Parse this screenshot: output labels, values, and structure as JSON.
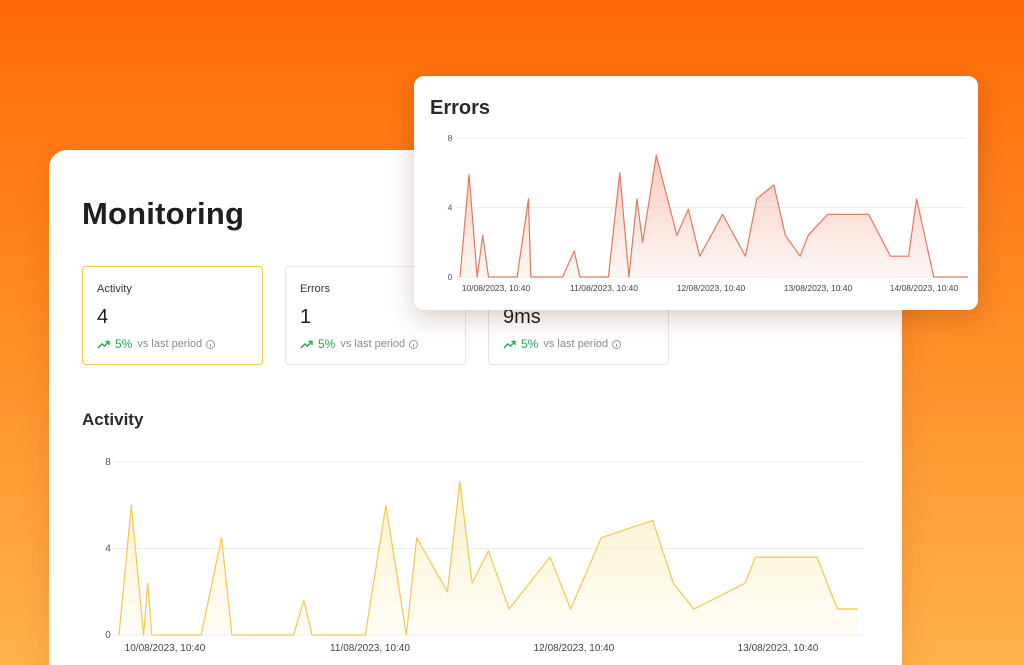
{
  "monitoring": {
    "title": "Monitoring",
    "stats": [
      {
        "label": "Activity",
        "value": "4",
        "trend_pct": "5%",
        "trend_text": "vs last period"
      },
      {
        "label": "Errors",
        "value": "1",
        "trend_pct": "5%",
        "trend_text": "vs last period"
      },
      {
        "label": "",
        "value": "9ms",
        "trend_pct": "5%",
        "trend_text": "vs last period"
      }
    ],
    "activity_title": "Activity"
  },
  "errors_card": {
    "title": "Errors"
  },
  "colors": {
    "activity_line": "#f2c94c",
    "activity_fill": "#fdf1c9",
    "errors_line": "#e07a5f",
    "errors_fill": "#f7c9bb",
    "trend_green": "#22a85a",
    "selected_border": "#f2c94c"
  },
  "chart_data": [
    {
      "type": "area",
      "title": "Errors",
      "ylim": [
        0,
        8
      ],
      "yticks": [
        "0",
        "4",
        "8"
      ],
      "xticks": [
        "10/08/2023, 10:40",
        "11/08/2023, 10:40",
        "12/08/2023, 10:40",
        "13/08/2023, 10:40",
        "14/08/2023, 10:40"
      ],
      "x_range": [
        0,
        4.38
      ],
      "grid": true,
      "series": [
        {
          "x": [
            0,
            0.08,
            0.15,
            0.2,
            0.25,
            0.3,
            0.5,
            0.6,
            0.62,
            0.68,
            0.9,
            1.0,
            1.05,
            1.12,
            1.3,
            1.4,
            1.48,
            1.55,
            1.6,
            1.72,
            1.9,
            2.0,
            2.1,
            2.3,
            2.5,
            2.6,
            2.75,
            2.85,
            2.98,
            3.05,
            3.22,
            3.33,
            3.42,
            3.58,
            3.77,
            3.8,
            3.93,
            4.0,
            4.15,
            4.22,
            4.45
          ],
          "y": [
            0,
            5.9,
            0,
            2.4,
            0,
            0,
            0,
            4.5,
            0,
            0,
            0,
            1.5,
            0,
            0,
            0,
            6,
            0,
            4.5,
            2,
            7,
            2.4,
            3.9,
            1.2,
            3.6,
            1.2,
            4.5,
            5.3,
            2.4,
            1.2,
            2.4,
            3.6,
            3.6,
            3.6,
            3.6,
            1.2,
            1.2,
            1.2,
            4.5,
            0,
            0,
            0
          ]
        }
      ]
    },
    {
      "type": "area",
      "title": "Activity",
      "ylim": [
        0,
        8
      ],
      "yticks": [
        "0",
        "4",
        "8"
      ],
      "xticks": [
        "10/08/2023, 10:40",
        "11/08/2023, 10:40",
        "12/08/2023, 10:40",
        "13/08/2023, 10:40"
      ],
      "x_range": [
        0,
        3.6
      ],
      "grid": true,
      "series": [
        {
          "x": [
            0,
            0.06,
            0.12,
            0.14,
            0.16,
            0.2,
            0.4,
            0.5,
            0.55,
            0.85,
            0.9,
            0.94,
            1.0,
            1.2,
            1.3,
            1.4,
            1.45,
            1.6,
            1.66,
            1.72,
            1.8,
            1.9,
            2.1,
            2.2,
            2.35,
            2.6,
            2.7,
            2.8,
            3.05,
            3.1,
            3.2,
            3.4,
            3.5,
            3.6
          ],
          "y": [
            0,
            6,
            0,
            2.4,
            0,
            0,
            0,
            4.5,
            0,
            0,
            1.6,
            0,
            0,
            0,
            6,
            0,
            4.5,
            2,
            7.1,
            2.4,
            3.9,
            1.2,
            3.6,
            1.2,
            4.5,
            5.3,
            2.4,
            1.2,
            2.4,
            3.6,
            3.6,
            3.6,
            1.2,
            1.2
          ]
        }
      ]
    }
  ]
}
